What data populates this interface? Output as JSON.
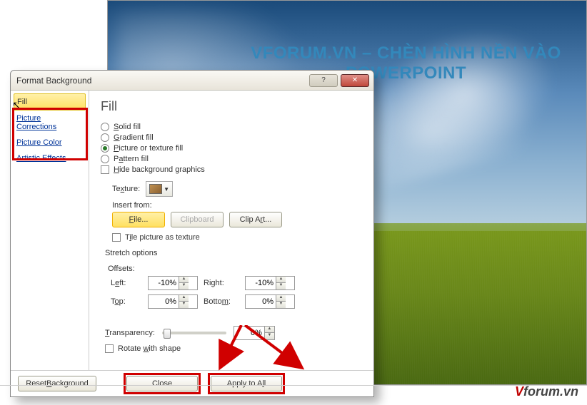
{
  "slide": {
    "title": "VFORUM.VN – CHÈN HÌNH NỀN VÀO POWERPOINT"
  },
  "dialog": {
    "title": "Format Background",
    "help": "?",
    "close_glyph": "✕",
    "nav": {
      "fill": "Fill",
      "corrections": "Picture Corrections",
      "color": "Picture Color",
      "effects": "Artistic Effects"
    },
    "content": {
      "heading": "Fill",
      "solid": "Solid fill",
      "gradient": "Gradient fill",
      "picture": "Picture or texture fill",
      "pattern": "Pattern fill",
      "hide": "Hide background graphics",
      "texture_lbl": "Texture:",
      "tex_arrow": "▼",
      "insert_from": "Insert from:",
      "file_btn": "File...",
      "clipboard_btn": "Clipboard",
      "clipart_btn": "Clip Art...",
      "tile": "Tile picture as texture",
      "stretch": "Stretch options",
      "offsets": "Offsets:",
      "left_lbl": "Left:",
      "right_lbl": "Right:",
      "top_lbl": "Top:",
      "bottom_lbl": "Bottom:",
      "left_val": "-10%",
      "right_val": "-10%",
      "top_val": "0%",
      "bottom_val": "0%",
      "transparency_lbl": "Transparency:",
      "transparency_val": "0%",
      "rotate": "Rotate with shape"
    },
    "footer": {
      "reset": "Reset Background",
      "close": "Close",
      "apply": "Apply to All"
    }
  },
  "watermark": {
    "pre": "V",
    "rest": "forum.vn"
  }
}
